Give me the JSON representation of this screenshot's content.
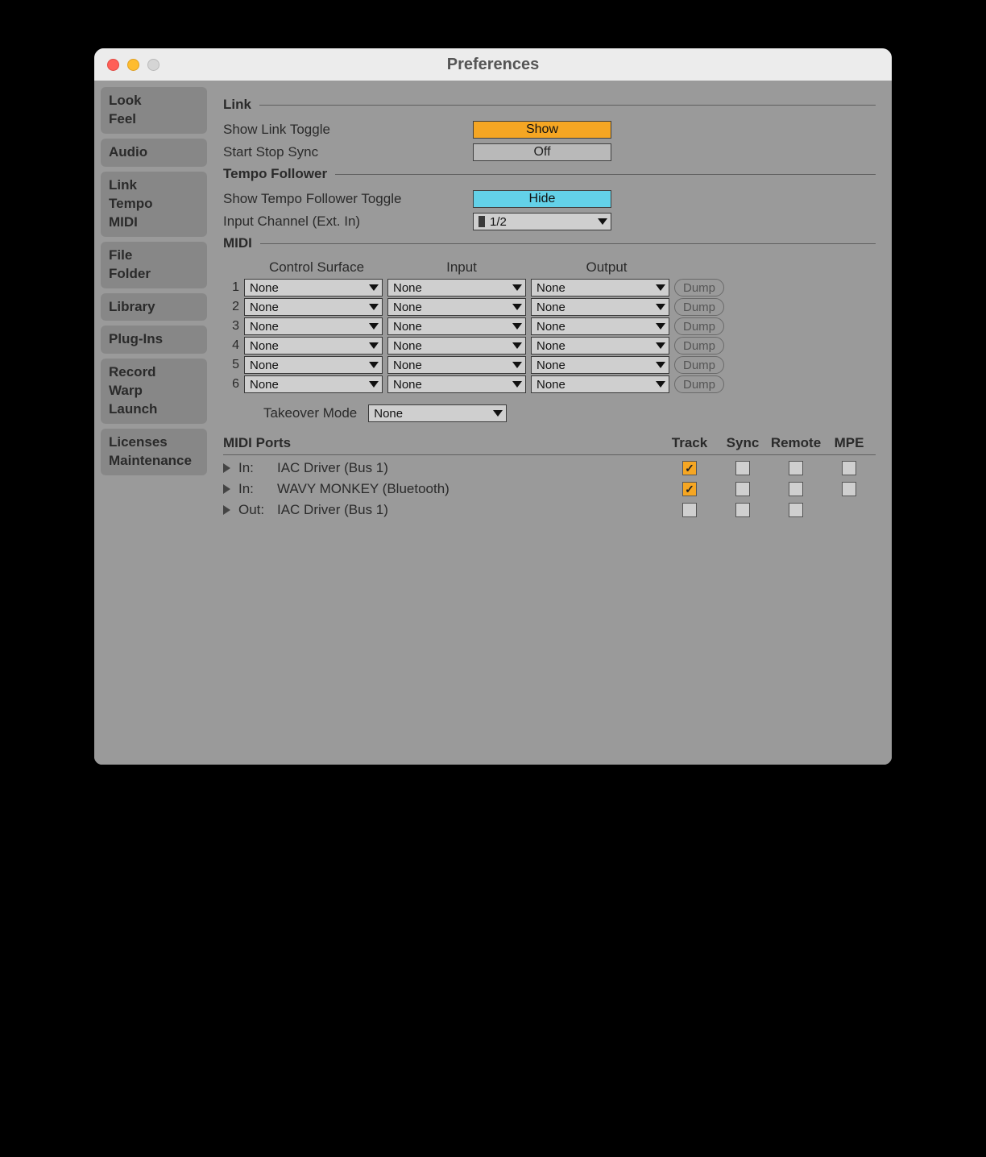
{
  "window": {
    "title": "Preferences"
  },
  "sidebar": {
    "items": [
      {
        "lines": [
          "Look",
          "Feel"
        ]
      },
      {
        "lines": [
          "Audio"
        ]
      },
      {
        "lines": [
          "Link",
          "Tempo",
          "MIDI"
        ]
      },
      {
        "lines": [
          "File",
          "Folder"
        ]
      },
      {
        "lines": [
          "Library"
        ]
      },
      {
        "lines": [
          "Plug-Ins"
        ]
      },
      {
        "lines": [
          "Record",
          "Warp",
          "Launch"
        ]
      },
      {
        "lines": [
          "Licenses",
          "Maintenance"
        ]
      }
    ]
  },
  "sections": {
    "link": {
      "title": "Link",
      "show_link_toggle_label": "Show Link Toggle",
      "show_link_toggle_value": "Show",
      "start_stop_sync_label": "Start Stop Sync",
      "start_stop_sync_value": "Off"
    },
    "tempo_follower": {
      "title": "Tempo Follower",
      "show_toggle_label": "Show Tempo Follower Toggle",
      "show_toggle_value": "Hide",
      "input_channel_label": "Input Channel (Ext. In)",
      "input_channel_value": "1/2"
    },
    "midi": {
      "title": "MIDI",
      "headers": {
        "control_surface": "Control Surface",
        "input": "Input",
        "output": "Output"
      },
      "rows": [
        {
          "n": "1",
          "cs": "None",
          "in": "None",
          "out": "None",
          "dump": "Dump"
        },
        {
          "n": "2",
          "cs": "None",
          "in": "None",
          "out": "None",
          "dump": "Dump"
        },
        {
          "n": "3",
          "cs": "None",
          "in": "None",
          "out": "None",
          "dump": "Dump"
        },
        {
          "n": "4",
          "cs": "None",
          "in": "None",
          "out": "None",
          "dump": "Dump"
        },
        {
          "n": "5",
          "cs": "None",
          "in": "None",
          "out": "None",
          "dump": "Dump"
        },
        {
          "n": "6",
          "cs": "None",
          "in": "None",
          "out": "None",
          "dump": "Dump"
        }
      ],
      "takeover_label": "Takeover Mode",
      "takeover_value": "None"
    },
    "midi_ports": {
      "title": "MIDI Ports",
      "cols": {
        "track": "Track",
        "sync": "Sync",
        "remote": "Remote",
        "mpe": "MPE"
      },
      "rows": [
        {
          "dir": "In:",
          "name": "IAC Driver (Bus 1)",
          "track": true,
          "sync": false,
          "remote": false,
          "mpe": false,
          "has_mpe": true
        },
        {
          "dir": "In:",
          "name": "WAVY MONKEY (Bluetooth)",
          "track": true,
          "sync": false,
          "remote": false,
          "mpe": false,
          "has_mpe": true
        },
        {
          "dir": "Out:",
          "name": "IAC Driver (Bus 1)",
          "track": false,
          "sync": false,
          "remote": false,
          "has_mpe": false
        }
      ]
    }
  }
}
